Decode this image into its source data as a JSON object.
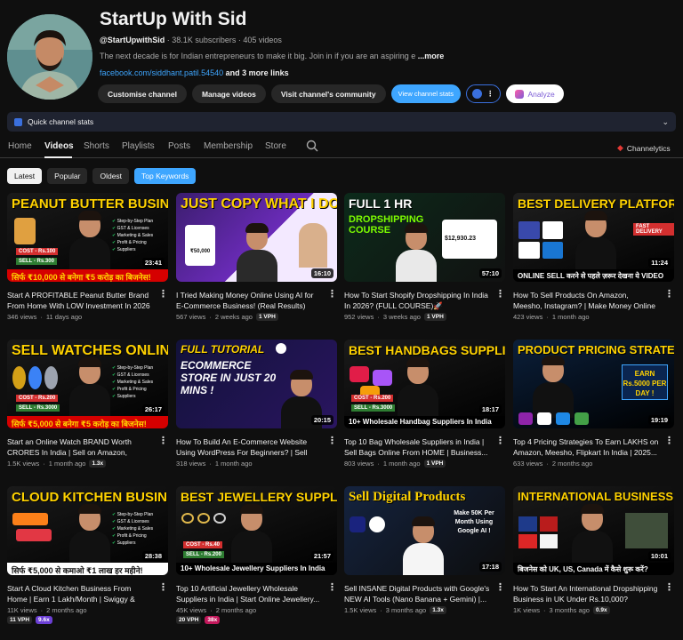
{
  "channel": {
    "name": "StartUp With Sid",
    "handle": "@StartUpwithSid",
    "subscribers": "38.1K subscribers",
    "videos_count": "405 videos",
    "description": "The next decade is for Indian entrepreneurs to make it big. Join in if you are an aspiring e",
    "more": "...more",
    "link": "facebook.com/siddhant.patil.54540",
    "link_more": "and 3 more links"
  },
  "buttons": {
    "customise": "Customise channel",
    "manage": "Manage videos",
    "revenue": "Visit channel's community",
    "view_stats": "View channel stats",
    "analyze": "Analyze"
  },
  "quick_stats": {
    "label": "Quick channel stats"
  },
  "tabs": [
    "Home",
    "Videos",
    "Shorts",
    "Playlists",
    "Posts",
    "Membership",
    "Store"
  ],
  "channelytics": "Channelytics",
  "filters": [
    "Latest",
    "Popular",
    "Oldest",
    "Top Keywords"
  ],
  "videos": [
    {
      "thumb_title": "PEANUT BUTTER BUSINESS",
      "thumb_sub": "सिर्फ ₹10,000 से बनेगा ₹5 करोड़ का बिजनेस!",
      "duration": "23:41",
      "title": "Start A PROFITABLE Peanut Butter Brand From Home With LOW Investment In 2026",
      "views": "346 views",
      "age": "11 days ago",
      "badge": ""
    },
    {
      "thumb_title": "JUST COPY WHAT I DO !",
      "thumb_sub": "",
      "duration": "16:10",
      "title": "I Tried Making Money Online Using AI for E-Commerce Business! (Real Results)",
      "views": "567 views",
      "age": "2 weeks ago",
      "badge": "1 VPH"
    },
    {
      "thumb_title": "FULL 1 HR",
      "thumb_sub": "DROPSHIPPING COURSE",
      "duration": "57:10",
      "title": "How To Start Shopify Dropshipping In India In 2026? (FULL COURSE)🚀",
      "views": "952 views",
      "age": "3 weeks ago",
      "badge": "1 VPH"
    },
    {
      "thumb_title": "BEST DELIVERY PLATFORMS",
      "thumb_sub": "ONLINE SELL करने से पहले ज़रूर देखना ये VIDEO",
      "duration": "11:24",
      "title": "How To Sell Products On Amazon, Meesho, Instagram? | Make Money Online | Busines...",
      "views": "423 views",
      "age": "1 month ago",
      "badge": ""
    },
    {
      "thumb_title": "SELL WATCHES ONLINE",
      "thumb_sub": "सिर्फ ₹5,000 से बनेगा ₹5 करोड़ का बिजनेस!",
      "duration": "26:17",
      "title": "Start an Online Watch BRAND Worth CRORES In India | Sell on Amazon, Instagra...",
      "views": "1.5K views",
      "age": "1 month ago",
      "badge": "1.3x"
    },
    {
      "thumb_title": "FULL TUTORIAL",
      "thumb_sub": "ECOMMERCE STORE IN JUST 20 MINS !",
      "duration": "20:15",
      "title": "How To Build An E-Commerce Website Using WordPress For Beginners? | Sell Products...",
      "views": "318 views",
      "age": "1 month ago",
      "badge": ""
    },
    {
      "thumb_title": "BEST HANDBAGS SUPPLIERS",
      "thumb_sub": "10+ Wholesale Handbag Suppliers In India",
      "duration": "18:17",
      "title": "Top 10 Bag Wholesale Suppliers in India | Sell Bags Online From HOME | Business...",
      "views": "803 views",
      "age": "1 month ago",
      "badge": "1 VPH"
    },
    {
      "thumb_title": "PRODUCT PRICING STRATEGY",
      "thumb_sub": "EARN Rs.5000 PER DAY !",
      "duration": "19:19",
      "title": "Top 4 Pricing Strategies To Earn LAKHS on Amazon, Meesho, Flipkart In India | 2025...",
      "views": "633 views",
      "age": "2 months ago",
      "badge": ""
    },
    {
      "thumb_title": "CLOUD KITCHEN BUSINESS",
      "thumb_sub": "सिर्फ ₹5,000 से कमाओ ₹1 लाख हर महीने!",
      "duration": "28:38",
      "title": "Start A Cloud Kitchen Business From Home | Earn 1 Lakh/Month | Swiggy & Zomato...",
      "views": "11K views",
      "age": "2 months ago",
      "badge": "",
      "vph": "11 VPH",
      "mult": "9.6x"
    },
    {
      "thumb_title": "BEST JEWELLERY SUPPLIERS",
      "thumb_sub": "10+ Wholesale Jewellery Suppliers In India",
      "duration": "21:57",
      "title": "Top 10 Artificial Jewellery Wholesale Suppliers in India | Start Online Jewellery...",
      "views": "45K views",
      "age": "2 months ago",
      "badge": "",
      "vph": "20 VPH",
      "mult": "38x"
    },
    {
      "thumb_title": "Sell Digital Products",
      "thumb_sub": "Make 50K Per Month Using Google AI !",
      "duration": "17:18",
      "title": "Sell INSANE Digital Products with Google's NEW AI Tools (Nano Banana + Gemini) |...",
      "views": "1.5K views",
      "age": "3 months ago",
      "badge": "1.3x"
    },
    {
      "thumb_title": "INTERNATIONAL BUSINESS",
      "thumb_sub": "बिजनेस को UK, US, Canada में कैसे शुरू करें?",
      "duration": "10:01",
      "title": "How To Start An International Dropshipping Business in UK Under Rs.10,000?",
      "views": "1K views",
      "age": "3 months ago",
      "badge": "0.9x"
    }
  ],
  "thumb_text": {
    "cost": "COST - Rs.100",
    "sell": "SELL - Rs.300",
    "cost2": "COST - Rs.200",
    "sell2": "SELL - Rs.3000",
    "cost3": "COST - Rs.40",
    "sell3": "SELL - Rs.200",
    "bullets": [
      "Step-by-Step Plan",
      "GST & Licenses",
      "Marketing & Sales",
      "Profit & Pricing",
      "Suppliers"
    ],
    "revenue": "$12,930.23",
    "price": "₹50,000",
    "fast": "FAST DELIVERY"
  },
  "colors": {
    "accent": "#3ea6ff",
    "bg": "#0f0f0f",
    "chip": "#272727",
    "red": "#d50000"
  }
}
